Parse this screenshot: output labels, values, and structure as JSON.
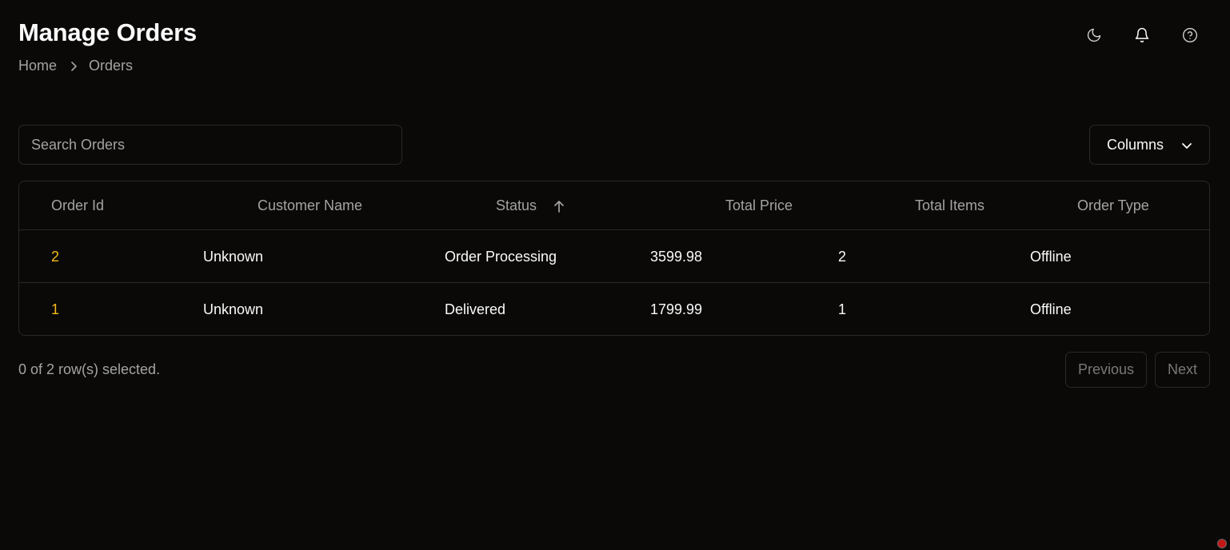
{
  "header": {
    "title": "Manage Orders",
    "breadcrumb": [
      "Home",
      "Orders"
    ]
  },
  "toolbar_icons": [
    "moon-icon",
    "bell-icon",
    "help-circle-icon"
  ],
  "search": {
    "placeholder": "Search Orders",
    "value": ""
  },
  "columns_button": {
    "label": "Columns"
  },
  "table": {
    "columns": [
      "Order Id",
      "Customer Name",
      "Status",
      "Total Price",
      "Total Items",
      "Order Type"
    ],
    "sorted_column": "Status",
    "sort_direction": "ascending",
    "rows": [
      {
        "order_id": "2",
        "customer_name": "Unknown",
        "status": "Order Processing",
        "total_price": "3599.98",
        "total_items": "2",
        "order_type": "Offline"
      },
      {
        "order_id": "1",
        "customer_name": "Unknown",
        "status": "Delivered",
        "total_price": "1799.99",
        "total_items": "1",
        "order_type": "Offline"
      }
    ]
  },
  "footer": {
    "selection_text": "0 of 2 row(s) selected.",
    "previous_label": "Previous",
    "next_label": "Next"
  },
  "colors": {
    "background": "#0a0908",
    "border": "#2a2826",
    "muted_text": "#a3a3a3",
    "accent_id": "#f5b91a"
  }
}
